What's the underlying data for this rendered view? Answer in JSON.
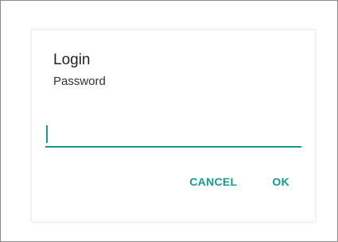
{
  "dialog": {
    "title": "Login",
    "message": "Password",
    "input": {
      "value": "",
      "placeholder": ""
    },
    "buttons": {
      "cancel_label": "CANCEL",
      "ok_label": "OK"
    }
  },
  "colors": {
    "accent": "#159a8c",
    "text": "#202020"
  }
}
